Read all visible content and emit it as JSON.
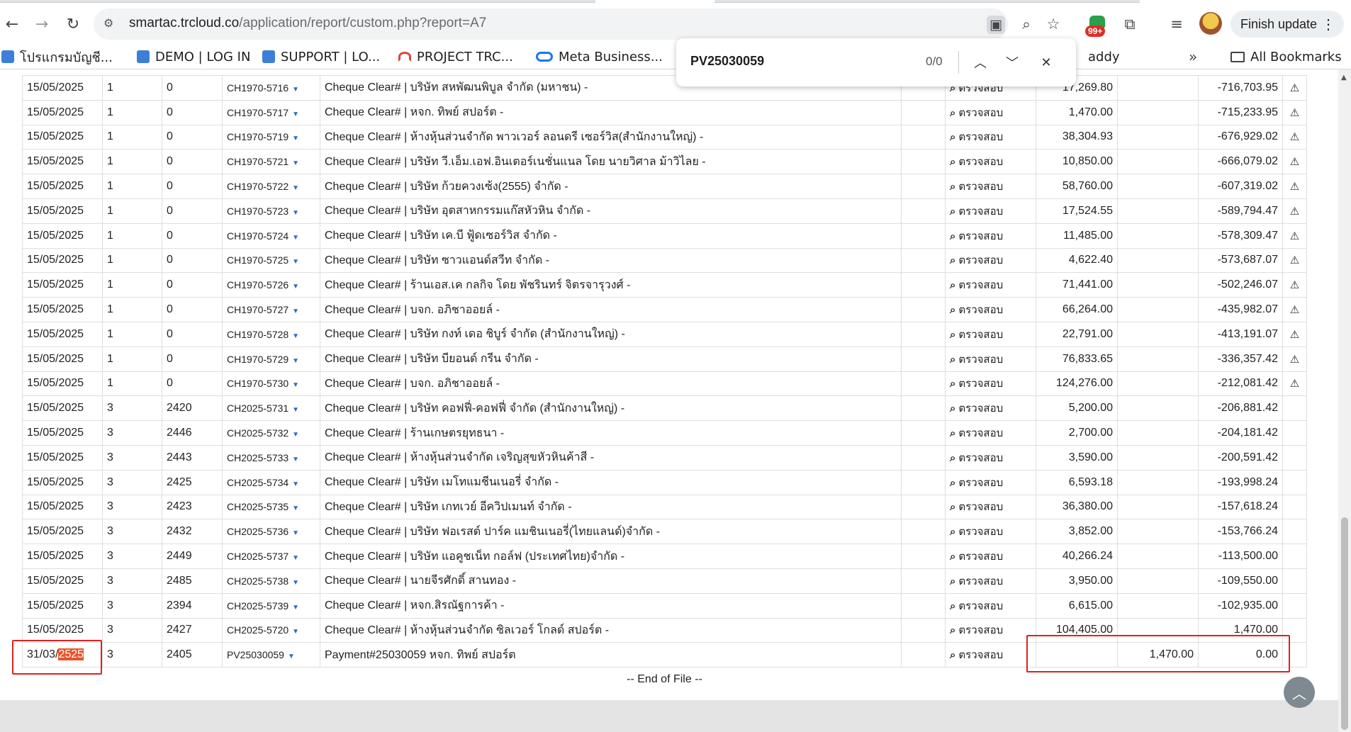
{
  "browser": {
    "url_host": "smartac.trcloud.co",
    "url_path": "/application/report/custom.php?report=A7",
    "extension_badge": "99+",
    "finish_update": "Finish update"
  },
  "bookmarks": [
    {
      "label": "โปรแกรมบัญชี...",
      "icon": "cloud-icon"
    },
    {
      "label": "DEMO | LOG IN",
      "icon": "cloud-icon"
    },
    {
      "label": "SUPPORT | LO...",
      "icon": "cloud-icon"
    },
    {
      "label": "PROJECT TRC...",
      "icon": "arc-icon"
    },
    {
      "label": "Meta Business...",
      "icon": "meta-icon"
    },
    {
      "label": "addy",
      "icon": ""
    }
  ],
  "all_bookmarks": "All Bookmarks",
  "find": {
    "query": "PV25030059",
    "count": "0/0"
  },
  "check_label": "ตรวจสอบ",
  "rows": [
    {
      "date": "15/05/2025",
      "c1": "1",
      "c2": "0",
      "doc": "CH1970-5716",
      "desc": "Cheque Clear# | บริษัท สหพัฒนพิบูล จำกัด (มหาชน) -",
      "amount": "17,269.80",
      "debit": "",
      "balance": "-716,703.95",
      "warn": true
    },
    {
      "date": "15/05/2025",
      "c1": "1",
      "c2": "0",
      "doc": "CH1970-5717",
      "desc": "Cheque Clear# | หจก. ทิพย์ สปอร์ต -",
      "amount": "1,470.00",
      "debit": "",
      "balance": "-715,233.95",
      "warn": true
    },
    {
      "date": "15/05/2025",
      "c1": "1",
      "c2": "0",
      "doc": "CH1970-5719",
      "desc": "Cheque Clear# | ห้างหุ้นส่วนจำกัด พาวเวอร์ ลอนดรี เซอร์วิส(สำนักงานใหญ่) -",
      "amount": "38,304.93",
      "debit": "",
      "balance": "-676,929.02",
      "warn": true
    },
    {
      "date": "15/05/2025",
      "c1": "1",
      "c2": "0",
      "doc": "CH1970-5721",
      "desc": "Cheque Clear# | บริษัท วี.เอ็ม.เอฟ.อินเตอร์เนชั่นแนล โดย นายวิศาล ม้าวิไลย -",
      "amount": "10,850.00",
      "debit": "",
      "balance": "-666,079.02",
      "warn": true
    },
    {
      "date": "15/05/2025",
      "c1": "1",
      "c2": "0",
      "doc": "CH1970-5722",
      "desc": "Cheque Clear# | บริษัท ก้วยควงเซ้ง(2555) จำกัด -",
      "amount": "58,760.00",
      "debit": "",
      "balance": "-607,319.02",
      "warn": true
    },
    {
      "date": "15/05/2025",
      "c1": "1",
      "c2": "0",
      "doc": "CH1970-5723",
      "desc": "Cheque Clear# | บริษัท อุตสาหกรรมแก๊สหัวหิน จำกัด -",
      "amount": "17,524.55",
      "debit": "",
      "balance": "-589,794.47",
      "warn": true
    },
    {
      "date": "15/05/2025",
      "c1": "1",
      "c2": "0",
      "doc": "CH1970-5724",
      "desc": "Cheque Clear# | บริษัท เค.บี ฟู้ดเซอร์วิส จำกัด -",
      "amount": "11,485.00",
      "debit": "",
      "balance": "-578,309.47",
      "warn": true
    },
    {
      "date": "15/05/2025",
      "c1": "1",
      "c2": "0",
      "doc": "CH1970-5725",
      "desc": "Cheque Clear# | บริษัท ซาวแอนด์สวีท จำกัด -",
      "amount": "4,622.40",
      "debit": "",
      "balance": "-573,687.07",
      "warn": true
    },
    {
      "date": "15/05/2025",
      "c1": "1",
      "c2": "0",
      "doc": "CH1970-5726",
      "desc": "Cheque Clear# | ร้านเอส.เค กลกิจ โดย พัชรินทร์ จิตรจารุวงศ์ -",
      "amount": "71,441.00",
      "debit": "",
      "balance": "-502,246.07",
      "warn": true
    },
    {
      "date": "15/05/2025",
      "c1": "1",
      "c2": "0",
      "doc": "CH1970-5727",
      "desc": "Cheque Clear# | บจก. อภิชาออยล์ -",
      "amount": "66,264.00",
      "debit": "",
      "balance": "-435,982.07",
      "warn": true
    },
    {
      "date": "15/05/2025",
      "c1": "1",
      "c2": "0",
      "doc": "CH1970-5728",
      "desc": "Cheque Clear# | บริษัท กงท์ เดอ ชิบูร์ จำกัด (สำนักงานใหญ่) -",
      "amount": "22,791.00",
      "debit": "",
      "balance": "-413,191.07",
      "warn": true
    },
    {
      "date": "15/05/2025",
      "c1": "1",
      "c2": "0",
      "doc": "CH1970-5729",
      "desc": "Cheque Clear# | บริษัท บียอนด์ กรีน จำกัด -",
      "amount": "76,833.65",
      "debit": "",
      "balance": "-336,357.42",
      "warn": true
    },
    {
      "date": "15/05/2025",
      "c1": "1",
      "c2": "0",
      "doc": "CH1970-5730",
      "desc": "Cheque Clear# | บจก. อภิชาออยล์ -",
      "amount": "124,276.00",
      "debit": "",
      "balance": "-212,081.42",
      "warn": true
    },
    {
      "date": "15/05/2025",
      "c1": "3",
      "c2": "2420",
      "doc": "CH2025-5731",
      "desc": "Cheque Clear# | บริษัท คอฟฟี่-คอฟฟี่ จำกัด (สำนักงานใหญ่) -",
      "amount": "5,200.00",
      "debit": "",
      "balance": "-206,881.42",
      "warn": false
    },
    {
      "date": "15/05/2025",
      "c1": "3",
      "c2": "2446",
      "doc": "CH2025-5732",
      "desc": "Cheque Clear# | ร้านเกษตรยุทธนา -",
      "amount": "2,700.00",
      "debit": "",
      "balance": "-204,181.42",
      "warn": false
    },
    {
      "date": "15/05/2025",
      "c1": "3",
      "c2": "2443",
      "doc": "CH2025-5733",
      "desc": "Cheque Clear# | ห้างหุ้นส่วนจำกัด เจริญสุขหัวหินค้าสี -",
      "amount": "3,590.00",
      "debit": "",
      "balance": "-200,591.42",
      "warn": false
    },
    {
      "date": "15/05/2025",
      "c1": "3",
      "c2": "2425",
      "doc": "CH2025-5734",
      "desc": "Cheque Clear# | บริษัท เมโทแมชีนเนอรี่ จำกัด -",
      "amount": "6,593.18",
      "debit": "",
      "balance": "-193,998.24",
      "warn": false
    },
    {
      "date": "15/05/2025",
      "c1": "3",
      "c2": "2423",
      "doc": "CH2025-5735",
      "desc": "Cheque Clear# | บริษัท เกทเวย์ อีควิปเมนท์ จำกัด -",
      "amount": "36,380.00",
      "debit": "",
      "balance": "-157,618.24",
      "warn": false
    },
    {
      "date": "15/05/2025",
      "c1": "3",
      "c2": "2432",
      "doc": "CH2025-5736",
      "desc": "Cheque Clear# | บริษัท ฟอเรสต์ ปาร์ค แมชินเนอรี่(ไทยแลนด์)จำกัด -",
      "amount": "3,852.00",
      "debit": "",
      "balance": "-153,766.24",
      "warn": false
    },
    {
      "date": "15/05/2025",
      "c1": "3",
      "c2": "2449",
      "doc": "CH2025-5737",
      "desc": "Cheque Clear# | บริษัท แอคูชเน็ท กอล์ฟ (ประเทศไทย)จำกัด -",
      "amount": "40,266.24",
      "debit": "",
      "balance": "-113,500.00",
      "warn": false
    },
    {
      "date": "15/05/2025",
      "c1": "3",
      "c2": "2485",
      "doc": "CH2025-5738",
      "desc": "Cheque Clear# | นายจีรศักดิ์ สานทอง -",
      "amount": "3,950.00",
      "debit": "",
      "balance": "-109,550.00",
      "warn": false
    },
    {
      "date": "15/05/2025",
      "c1": "3",
      "c2": "2394",
      "doc": "CH2025-5739",
      "desc": "Cheque Clear# | หจก.สิรณัฐการค้า -",
      "amount": "6,615.00",
      "debit": "",
      "balance": "-102,935.00",
      "warn": false
    },
    {
      "date": "15/05/2025",
      "c1": "3",
      "c2": "2427",
      "doc": "CH2025-5720",
      "desc": "Cheque Clear# | ห้างหุ้นส่วนจำกัด ซิลเวอร์ โกลด์ สปอร์ต -",
      "amount": "104,405.00",
      "debit": "",
      "balance": "1,470.00",
      "warn": false
    }
  ],
  "payment_row": {
    "date_prefix": "31/03/",
    "date_highlight": "2525",
    "c1": "3",
    "c2": "2405",
    "doc": "PV25030059",
    "desc": "Payment#25030059 หจก. ทิพย์ สปอร์ต",
    "amount": "",
    "debit": "1,470.00",
    "balance": "0.00"
  },
  "end_of_file": "-- End of File --"
}
